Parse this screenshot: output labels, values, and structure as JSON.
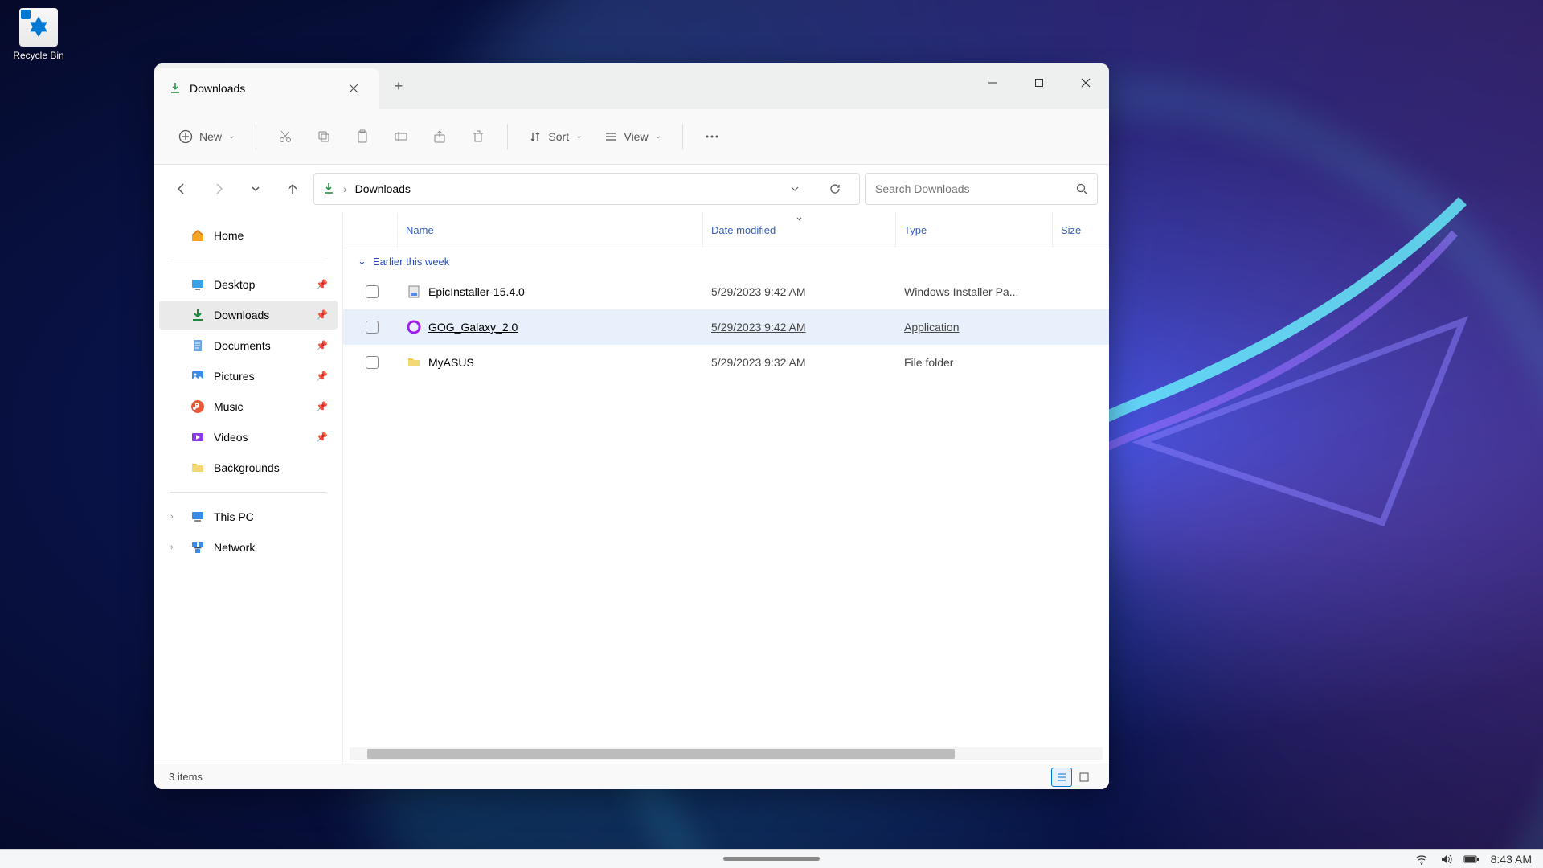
{
  "desktop": {
    "recycle_bin": "Recycle Bin"
  },
  "window": {
    "tab_title": "Downloads",
    "toolbar": {
      "new": "New",
      "sort": "Sort",
      "view": "View"
    },
    "breadcrumb": "Downloads",
    "search_placeholder": "Search Downloads",
    "sidebar": {
      "home": "Home",
      "desktop": "Desktop",
      "downloads": "Downloads",
      "documents": "Documents",
      "pictures": "Pictures",
      "music": "Music",
      "videos": "Videos",
      "backgrounds": "Backgrounds",
      "this_pc": "This PC",
      "network": "Network"
    },
    "columns": {
      "name": "Name",
      "date": "Date modified",
      "type": "Type",
      "size": "Size"
    },
    "group_label": "Earlier this week",
    "files": [
      {
        "name": "EpicInstaller-15.4.0",
        "date": "5/29/2023 9:42 AM",
        "type": "Windows Installer Pa..."
      },
      {
        "name": "GOG_Galaxy_2.0",
        "date": "5/29/2023 9:42 AM",
        "type": "Application"
      },
      {
        "name": "MyASUS",
        "date": "5/29/2023 9:32 AM",
        "type": "File folder"
      }
    ],
    "status": "3 items"
  },
  "systray": {
    "time": "8:43 AM"
  }
}
